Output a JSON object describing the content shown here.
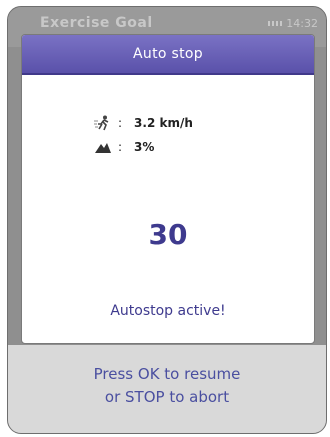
{
  "background_screen": {
    "title": "Exercise Goal",
    "time": "14:32"
  },
  "dialog": {
    "title": "Auto stop",
    "speed_value": "3.2 km/h",
    "incline_value": "3%",
    "countdown": "30",
    "status_message": "Autostop active!",
    "colon": ":"
  },
  "footer": {
    "line1": "Press OK to resume",
    "line2": "or STOP to abort"
  },
  "colors": {
    "accent": "#5a51aa",
    "text_accent": "#3e3a8e"
  }
}
